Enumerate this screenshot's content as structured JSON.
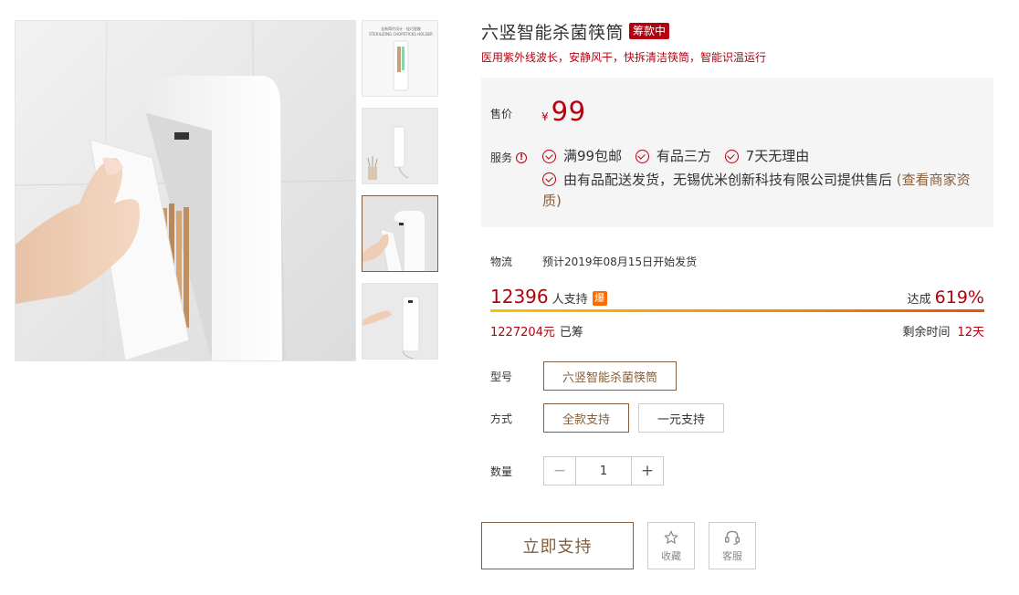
{
  "gallery": {
    "thumb_caption_line1": "全新简约设计 · 轻巧智能",
    "thumb_caption_line2": "STERILIZING CHOPSTICKS HOLDER",
    "active_thumb_index": 2
  },
  "product": {
    "title": "六竖智能杀菌筷筒",
    "status_badge": "筹款中",
    "subtitle": "医用紫外线波长，安静风干，快拆清洁筷筒，智能识温运行"
  },
  "price": {
    "label": "售价",
    "currency": "¥",
    "value": "99"
  },
  "service": {
    "label": "服务",
    "info_icon": "!",
    "items": [
      "满99包邮",
      "有品三方",
      "7天无理由"
    ],
    "seller_text": "由有品配送发货，无锡优米创新科技有限公司提供售后",
    "seller_link": "(查看商家资质)"
  },
  "logistics": {
    "label": "物流",
    "value": "预计2019年08月15日开始发货"
  },
  "crowdfunding": {
    "supporters": "12396",
    "supporters_text": "人支持",
    "hot_badge": "爆",
    "achieved_label": "达成",
    "achieved_value": "619%",
    "progress_fraction": 1.0,
    "raised_amount": "1227204元",
    "raised_text": "已筹",
    "remaining_label": "剩余时间",
    "remaining_value": "12天"
  },
  "options": {
    "model_label": "型号",
    "model_choice": "六竖智能杀菌筷筒",
    "method_label": "方式",
    "method_choices": [
      "全款支持",
      "一元支持"
    ],
    "method_selected": 0,
    "quantity_label": "数量",
    "quantity_value": "1",
    "minus": "−",
    "plus": "+"
  },
  "actions": {
    "support_button": "立即支持",
    "favorite_label": "收藏",
    "service_label": "客服"
  },
  "colors": {
    "accent": "#b4000f",
    "brand": "#845f3f",
    "hot": "#ff6a00",
    "panel": "#f5f5f5"
  }
}
